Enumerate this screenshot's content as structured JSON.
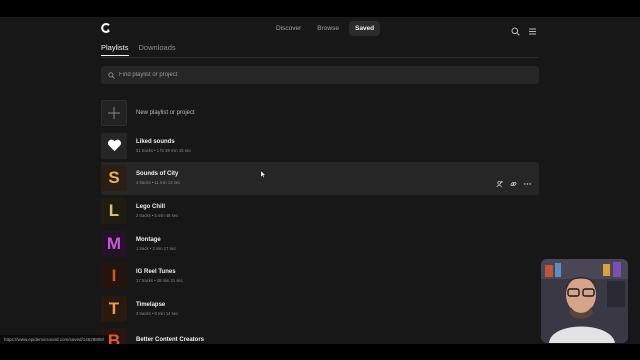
{
  "nav": {
    "tabs": [
      {
        "label": "Discover",
        "active": false
      },
      {
        "label": "Browse",
        "active": false
      },
      {
        "label": "Saved",
        "active": true
      }
    ],
    "icons": [
      "search-icon",
      "menu-icon"
    ]
  },
  "section_tabs": [
    {
      "label": "Playlists",
      "active": true
    },
    {
      "label": "Downloads",
      "active": false
    }
  ],
  "search": {
    "placeholder": "Find playlist or project"
  },
  "new_item": {
    "label": "New playlist or project"
  },
  "playlists": [
    {
      "title": "Liked sounds",
      "meta": "31 tracks • 1 hr 39 min 15 sec",
      "glyph": "heart-icon",
      "letter": "",
      "color": "#ffffff"
    },
    {
      "title": "Sounds of City",
      "meta": "4 tracks • 11 min 13 sec",
      "glyph": "",
      "letter": "S",
      "color": "#e8b25c"
    },
    {
      "title": "Lego Chill",
      "meta": "2 tracks • 5 min 48 sec",
      "glyph": "",
      "letter": "L",
      "color": "#d8c477"
    },
    {
      "title": "Montage",
      "meta": "1 track • 3 min 17 sec",
      "glyph": "",
      "letter": "M",
      "color": "#c55bd9"
    },
    {
      "title": "IG Reel Tunes",
      "meta": "17 tracks • 48 min 21 sec",
      "glyph": "",
      "letter": "I",
      "color": "#d9542e"
    },
    {
      "title": "Timelapse",
      "meta": "3 tracks • 8 min 14 sec",
      "glyph": "",
      "letter": "T",
      "color": "#f09a45"
    },
    {
      "title": "Better Content Creators",
      "meta": "",
      "glyph": "",
      "letter": "B",
      "color": "#e05a3a"
    }
  ],
  "hover_row_actions": [
    "add-collaborator-icon",
    "link-icon",
    "more-icon"
  ],
  "status_url": "https://www.epidemicsound.com/saved/14628808/"
}
